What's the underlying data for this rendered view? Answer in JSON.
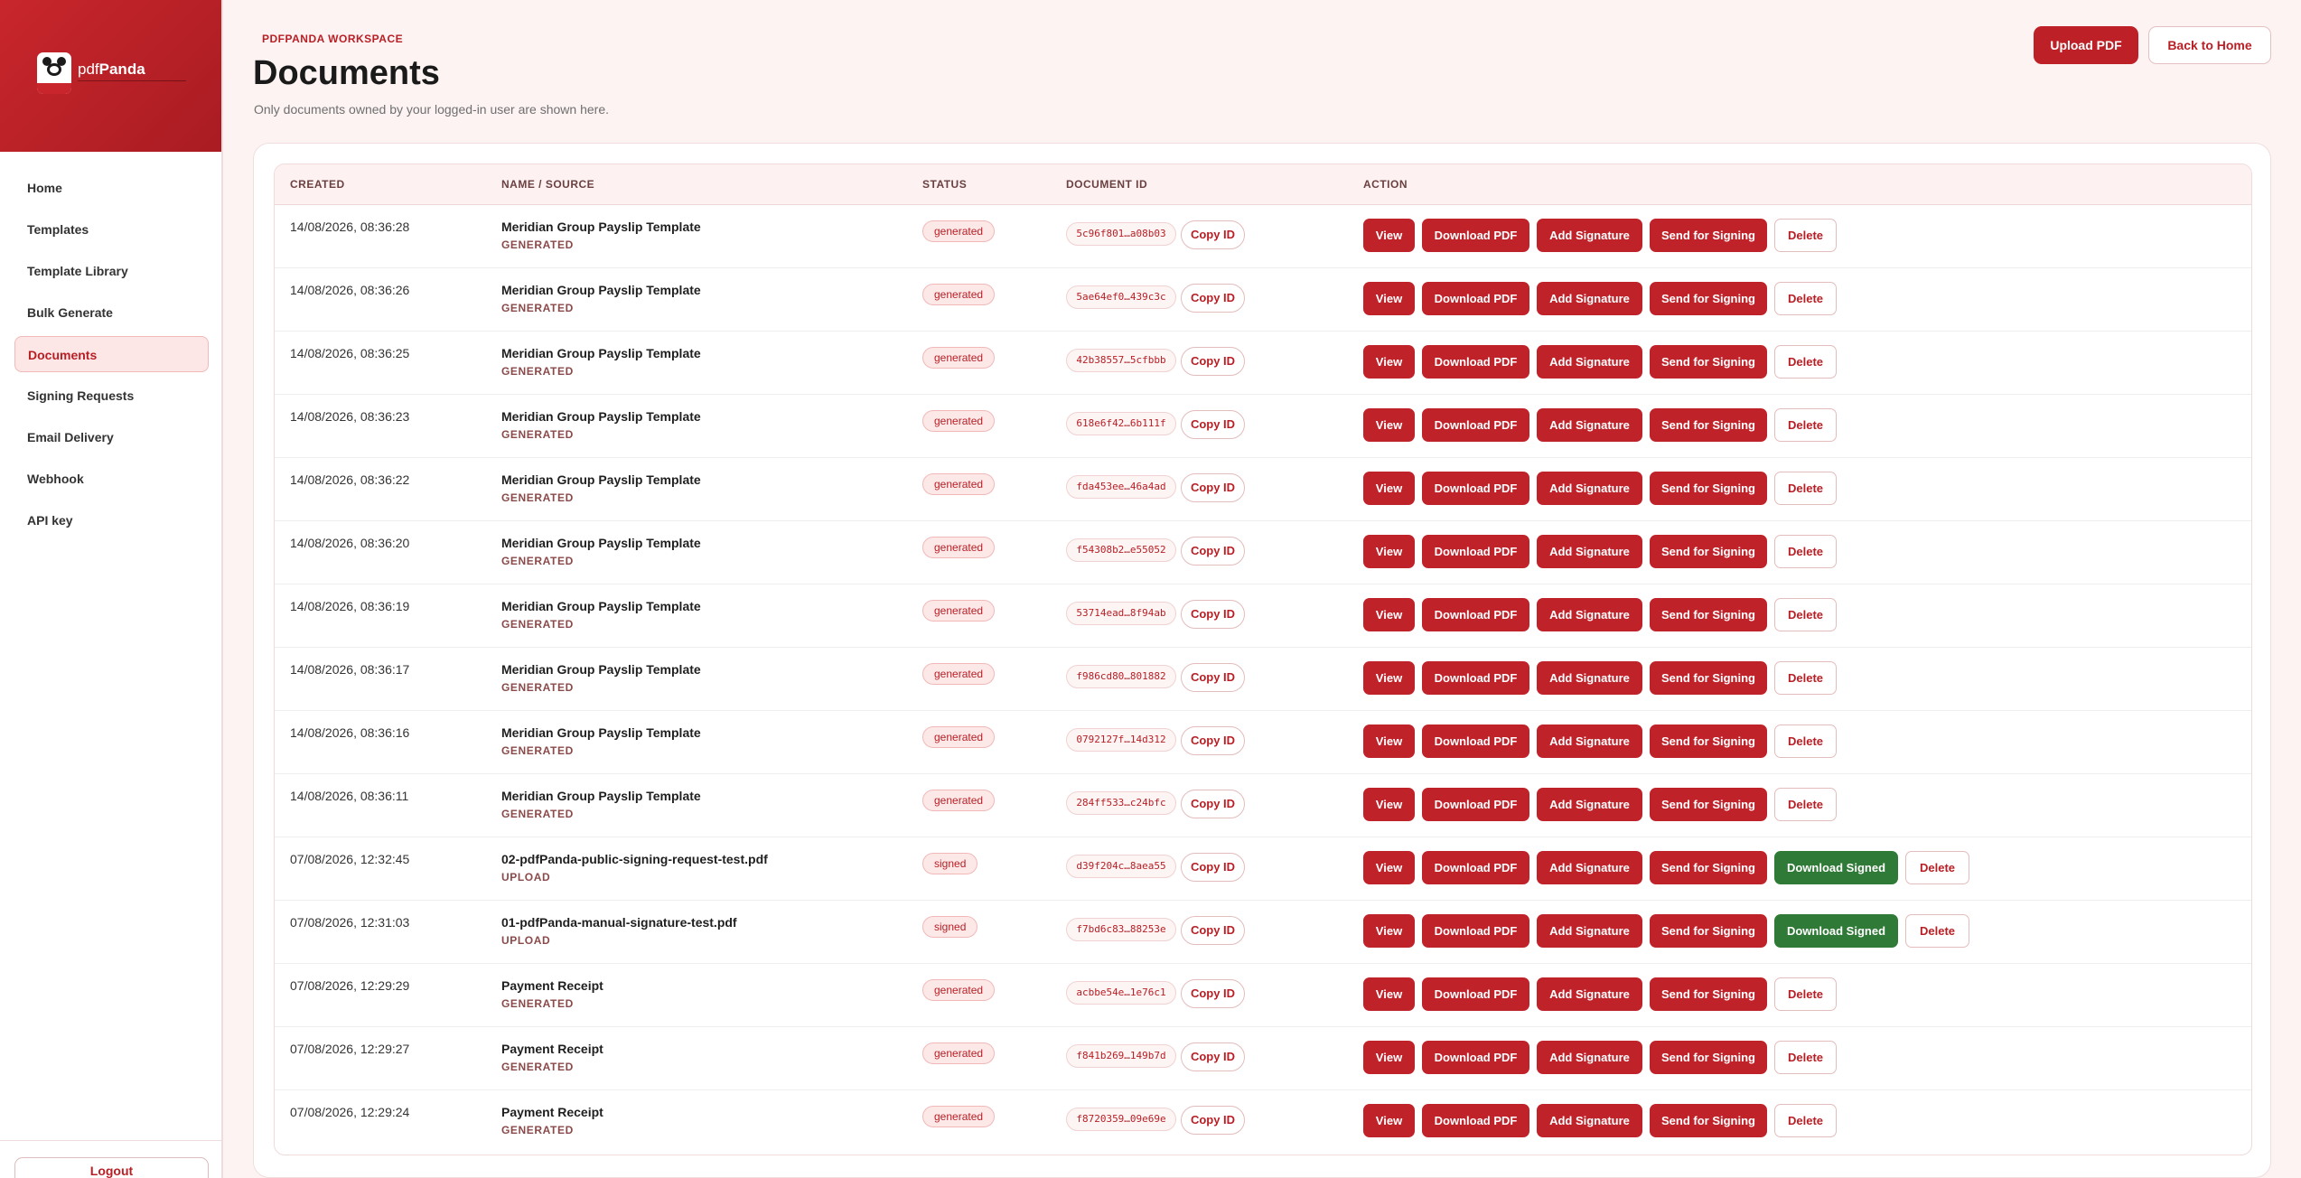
{
  "brand": {
    "name_prefix": "pdf",
    "name_suffix": "Panda"
  },
  "sidebar": {
    "items": [
      {
        "label": "Home"
      },
      {
        "label": "Templates"
      },
      {
        "label": "Template Library"
      },
      {
        "label": "Bulk Generate"
      },
      {
        "label": "Documents",
        "active": true
      },
      {
        "label": "Signing Requests"
      },
      {
        "label": "Email Delivery"
      },
      {
        "label": "Webhook"
      },
      {
        "label": "API key"
      }
    ],
    "logout_label": "Logout"
  },
  "header": {
    "eyebrow": "PDFPANDA WORKSPACE",
    "title": "Documents",
    "subtitle": "Only documents owned by your logged-in user are shown here.",
    "upload_label": "Upload PDF",
    "home_label": "Back to Home"
  },
  "table": {
    "columns": [
      "CREATED",
      "NAME / SOURCE",
      "STATUS",
      "DOCUMENT ID",
      "ACTION"
    ],
    "copy_label": "Copy ID",
    "action_labels": {
      "view": "View",
      "download": "Download PDF",
      "add_signature": "Add Signature",
      "send": "Send for Signing",
      "download_signed": "Download Signed",
      "delete": "Delete"
    },
    "rows": [
      {
        "created": "14/08/2026, 08:36:28",
        "name": "Meridian Group Payslip Template",
        "source": "GENERATED",
        "status": "generated",
        "doc_id": "5c96f801…a08b03"
      },
      {
        "created": "14/08/2026, 08:36:26",
        "name": "Meridian Group Payslip Template",
        "source": "GENERATED",
        "status": "generated",
        "doc_id": "5ae64ef0…439c3c"
      },
      {
        "created": "14/08/2026, 08:36:25",
        "name": "Meridian Group Payslip Template",
        "source": "GENERATED",
        "status": "generated",
        "doc_id": "42b38557…5cfbbb"
      },
      {
        "created": "14/08/2026, 08:36:23",
        "name": "Meridian Group Payslip Template",
        "source": "GENERATED",
        "status": "generated",
        "doc_id": "618e6f42…6b111f"
      },
      {
        "created": "14/08/2026, 08:36:22",
        "name": "Meridian Group Payslip Template",
        "source": "GENERATED",
        "status": "generated",
        "doc_id": "fda453ee…46a4ad"
      },
      {
        "created": "14/08/2026, 08:36:20",
        "name": "Meridian Group Payslip Template",
        "source": "GENERATED",
        "status": "generated",
        "doc_id": "f54308b2…e55052"
      },
      {
        "created": "14/08/2026, 08:36:19",
        "name": "Meridian Group Payslip Template",
        "source": "GENERATED",
        "status": "generated",
        "doc_id": "53714ead…8f94ab"
      },
      {
        "created": "14/08/2026, 08:36:17",
        "name": "Meridian Group Payslip Template",
        "source": "GENERATED",
        "status": "generated",
        "doc_id": "f986cd80…801882"
      },
      {
        "created": "14/08/2026, 08:36:16",
        "name": "Meridian Group Payslip Template",
        "source": "GENERATED",
        "status": "generated",
        "doc_id": "0792127f…14d312"
      },
      {
        "created": "14/08/2026, 08:36:11",
        "name": "Meridian Group Payslip Template",
        "source": "GENERATED",
        "status": "generated",
        "doc_id": "284ff533…c24bfc"
      },
      {
        "created": "07/08/2026, 12:32:45",
        "name": "02-pdfPanda-public-signing-request-test.pdf",
        "source": "UPLOAD",
        "status": "signed",
        "doc_id": "d39f204c…8aea55"
      },
      {
        "created": "07/08/2026, 12:31:03",
        "name": "01-pdfPanda-manual-signature-test.pdf",
        "source": "UPLOAD",
        "status": "signed",
        "doc_id": "f7bd6c83…88253e"
      },
      {
        "created": "07/08/2026, 12:29:29",
        "name": "Payment Receipt",
        "source": "GENERATED",
        "status": "generated",
        "doc_id": "acbbe54e…1e76c1"
      },
      {
        "created": "07/08/2026, 12:29:27",
        "name": "Payment Receipt",
        "source": "GENERATED",
        "status": "generated",
        "doc_id": "f841b269…149b7d"
      },
      {
        "created": "07/08/2026, 12:29:24",
        "name": "Payment Receipt",
        "source": "GENERATED",
        "status": "generated",
        "doc_id": "f8720359…09e69e"
      }
    ]
  },
  "colors": {
    "accent": "#c0222a",
    "signed_action": "#2f7a36",
    "background": "#fdf3f3"
  }
}
